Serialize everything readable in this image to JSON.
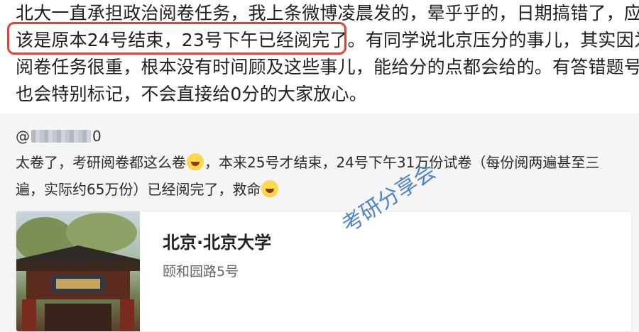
{
  "post": {
    "lines": [
      "北大一直承担政治阅卷任务，我上条微博凌晨发的，晕乎乎的，日期搞错了，应",
      "该是原本24号结束，23号下午已经阅完了。",
      "有同学说北京压分的事儿，其实因为",
      "阅卷任务很重，根本没有时间顾及这些事儿，能给分的点都会给的。有答错题号",
      "也会特别标记，不会直接给0分的大家放心。"
    ],
    "highlight_color": "#e0442f"
  },
  "repost": {
    "user_prefix": "@",
    "user_suffix": "0",
    "line1_a": "太卷了，考研阅卷都这么卷",
    "line1_b": "，本来25号才结束，24号下午31万份试卷（每份阅两遍甚至三",
    "line2_a": "遍，实际约65万份）已经阅完了，救命",
    "emoji_icon": "laugh-cry-emoji-icon"
  },
  "location_card": {
    "title": "北京·北京大学",
    "address": "颐和园路5号"
  },
  "watermark": "考研分享会",
  "colors": {
    "background": "#ffffff",
    "repost_bg": "#f5f5f5",
    "watermark": "#3d78c7"
  }
}
